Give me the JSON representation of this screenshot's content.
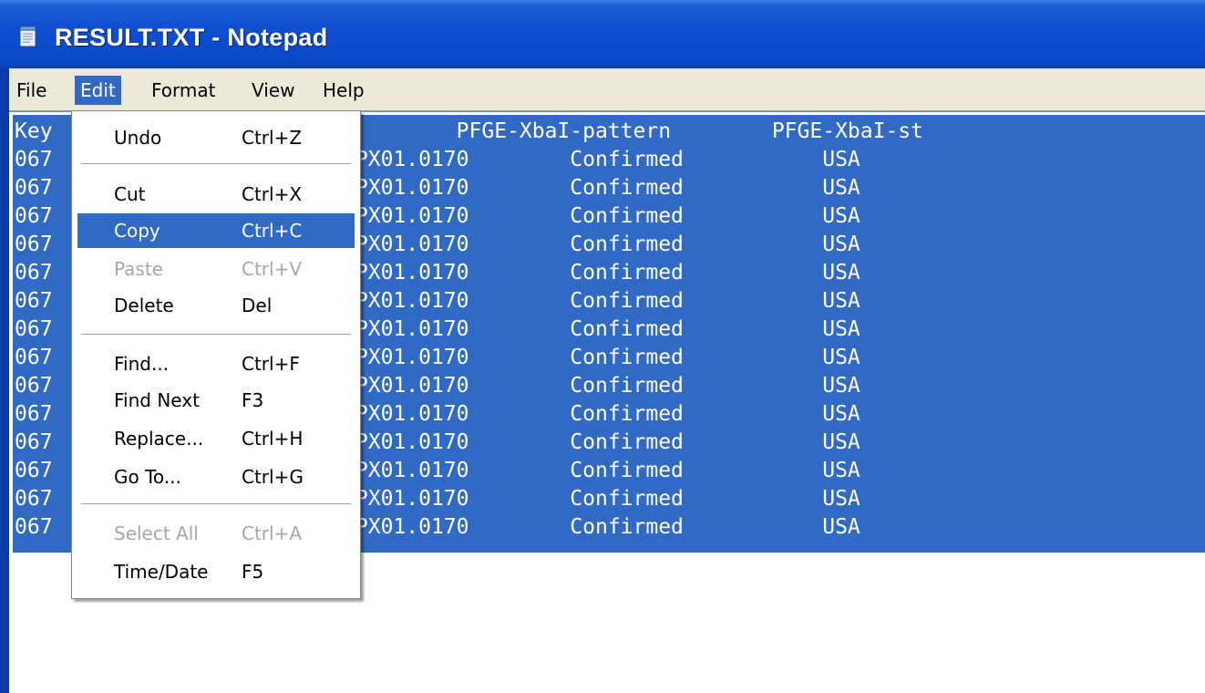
{
  "window": {
    "title": "RESULT.TXT - Notepad"
  },
  "menubar": {
    "items": [
      "File",
      "Edit",
      "Format",
      "View",
      "Help"
    ],
    "active": "Edit"
  },
  "edit_menu": {
    "items": [
      {
        "label": "Undo",
        "shortcut": "Ctrl+Z"
      },
      {
        "label": "Cut",
        "shortcut": "Ctrl+X"
      },
      {
        "label": "Copy",
        "shortcut": "Ctrl+C"
      },
      {
        "label": "Paste",
        "shortcut": "Ctrl+V"
      },
      {
        "label": "Delete",
        "shortcut": "Del"
      },
      {
        "label": "Find...",
        "shortcut": "Ctrl+F"
      },
      {
        "label": "Find Next",
        "shortcut": "F3"
      },
      {
        "label": "Replace...",
        "shortcut": "Ctrl+H"
      },
      {
        "label": "Go To...",
        "shortcut": "Ctrl+G"
      },
      {
        "label": "Select All",
        "shortcut": "Ctrl+A"
      },
      {
        "label": "Time/Date",
        "shortcut": "F5"
      }
    ],
    "highlighted": "Copy",
    "disabled": [
      "Paste",
      "Select All"
    ]
  },
  "editor": {
    "visible_lines": [
      "Key                 type           PFGE-XbaI-pattern        PFGE-XbaI-st",
      "067                 ort  JJPX01.0170        Confirmed           USA",
      "067                 ort  JJPX01.0170        Confirmed           USA",
      "067                 ort  JJPX01.0170        Confirmed           USA",
      "067                 ort  JJPX01.0170        Confirmed           USA",
      "067                 ort  JJPX01.0170        Confirmed           USA",
      "067                 ort  JJPX01.0170        Confirmed           USA",
      "067                 ort  JJPX01.0170        Confirmed           USA",
      "067                 ort  JJPX01.0170        Confirmed           USA",
      "067                 ort  JJPX01.0170        Confirmed           USA",
      "067                 ort  JJPX01.0170        Confirmed           USA",
      "067                 ort  JJPX01.0170        Confirmed           USA",
      "067                 ort  JJPX01.0170        Confirmed           USA",
      "067                 ort  JJPX01.0170        Confirmed           USA",
      "067                 ort  JJPX01.0170        Confirmed           USA"
    ]
  },
  "colors": {
    "titlebar": "#0a49c8",
    "selection": "#316ac5",
    "menubar": "#ece9d8"
  }
}
